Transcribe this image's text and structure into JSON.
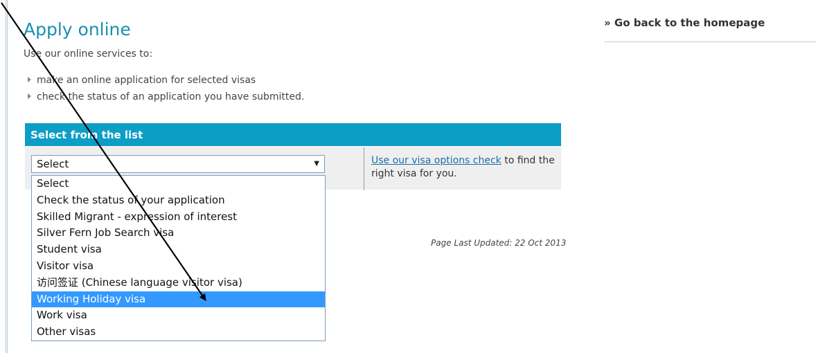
{
  "page": {
    "title": "Apply online",
    "intro": "Use our online services to:",
    "bullets": [
      "make an online application for selected visas",
      "check the status of an application you have submitted."
    ],
    "last_updated": "Page Last Updated: 22 Oct 2013"
  },
  "sidebar": {
    "back_link": "» Go back to the homepage"
  },
  "visa_panel": {
    "header": "Select from the list",
    "select": {
      "current_value": "Select",
      "options": [
        "Select",
        "Check the status of your application",
        "Skilled Migrant - expression of interest",
        "Silver Fern Job Search visa",
        "Student visa",
        "Visitor visa",
        "访问签证 (Chinese language visitor visa)",
        "Working Holiday visa",
        "Work visa",
        "Other visas"
      ],
      "highlighted_option": "Working Holiday visa"
    },
    "help_link": "Use our visa options check",
    "help_text_rest": " to find the right visa for you."
  },
  "colors": {
    "title_blue": "#1a8fb0",
    "panel_header_bg": "#0d9ec6",
    "highlight_bg": "#3399ff",
    "link_blue": "#1a6fa8"
  }
}
